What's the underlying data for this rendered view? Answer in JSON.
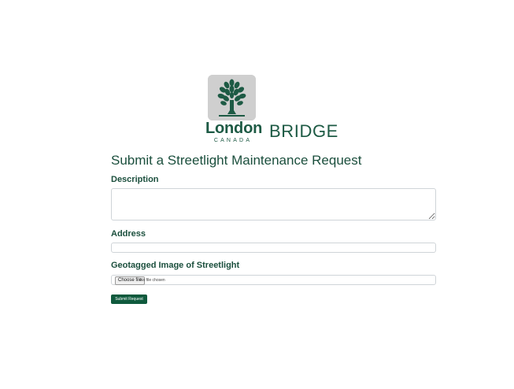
{
  "header": {
    "logo_word": "London",
    "logo_sub": "CANADA",
    "brand": "BRIDGE"
  },
  "page": {
    "title": "Submit a Streetlight Maintenance Request"
  },
  "form": {
    "description_label": "Description",
    "description_value": "",
    "address_label": "Address",
    "address_value": "",
    "image_label": "Geotagged Image of Streetlight",
    "file_button_label": "Choose file",
    "file_status": "No file chosen",
    "submit_label": "Submit Request"
  },
  "colors": {
    "brand_green": "#1d5a44",
    "button_green": "#0f5a3d",
    "logo_tile": "#cfcfcf"
  },
  "icons": {
    "logo": "tree-icon"
  }
}
